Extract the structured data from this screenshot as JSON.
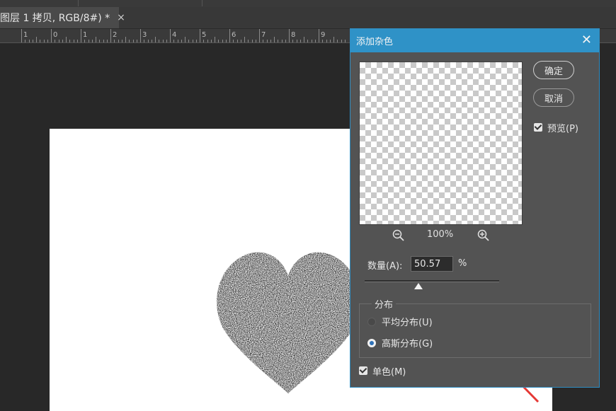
{
  "document": {
    "tab_title": "图层 1 拷贝, RGB/8#) *",
    "tab_close": "×",
    "ruler_labels": [
      "1",
      "0",
      "1",
      "2",
      "3",
      "4",
      "5",
      "6",
      "7",
      "8",
      "9"
    ]
  },
  "dialog": {
    "title": "添加杂色",
    "close_glyph": "✕",
    "ok_label": "确定",
    "cancel_label": "取消",
    "preview_label": "预览(P)",
    "preview_checked": true,
    "zoom_value": "100%",
    "amount_label": "数量(A):",
    "amount_value": "50.57",
    "amount_unit": "%",
    "amount_slider_fraction": 0.4,
    "distribution_legend": "分布",
    "uniform_label": "平均分布(U)",
    "gaussian_label": "高斯分布(G)",
    "selected_distribution": "gaussian",
    "monochromatic_label": "单色(M)",
    "monochromatic_checked": true
  },
  "colors": {
    "accent": "#2f92c7",
    "annotation_arrow": "#e53935"
  },
  "icons": [
    "close-icon",
    "zoom-out-icon",
    "zoom-in-icon",
    "checkbox-icon",
    "annotation-arrow"
  ]
}
